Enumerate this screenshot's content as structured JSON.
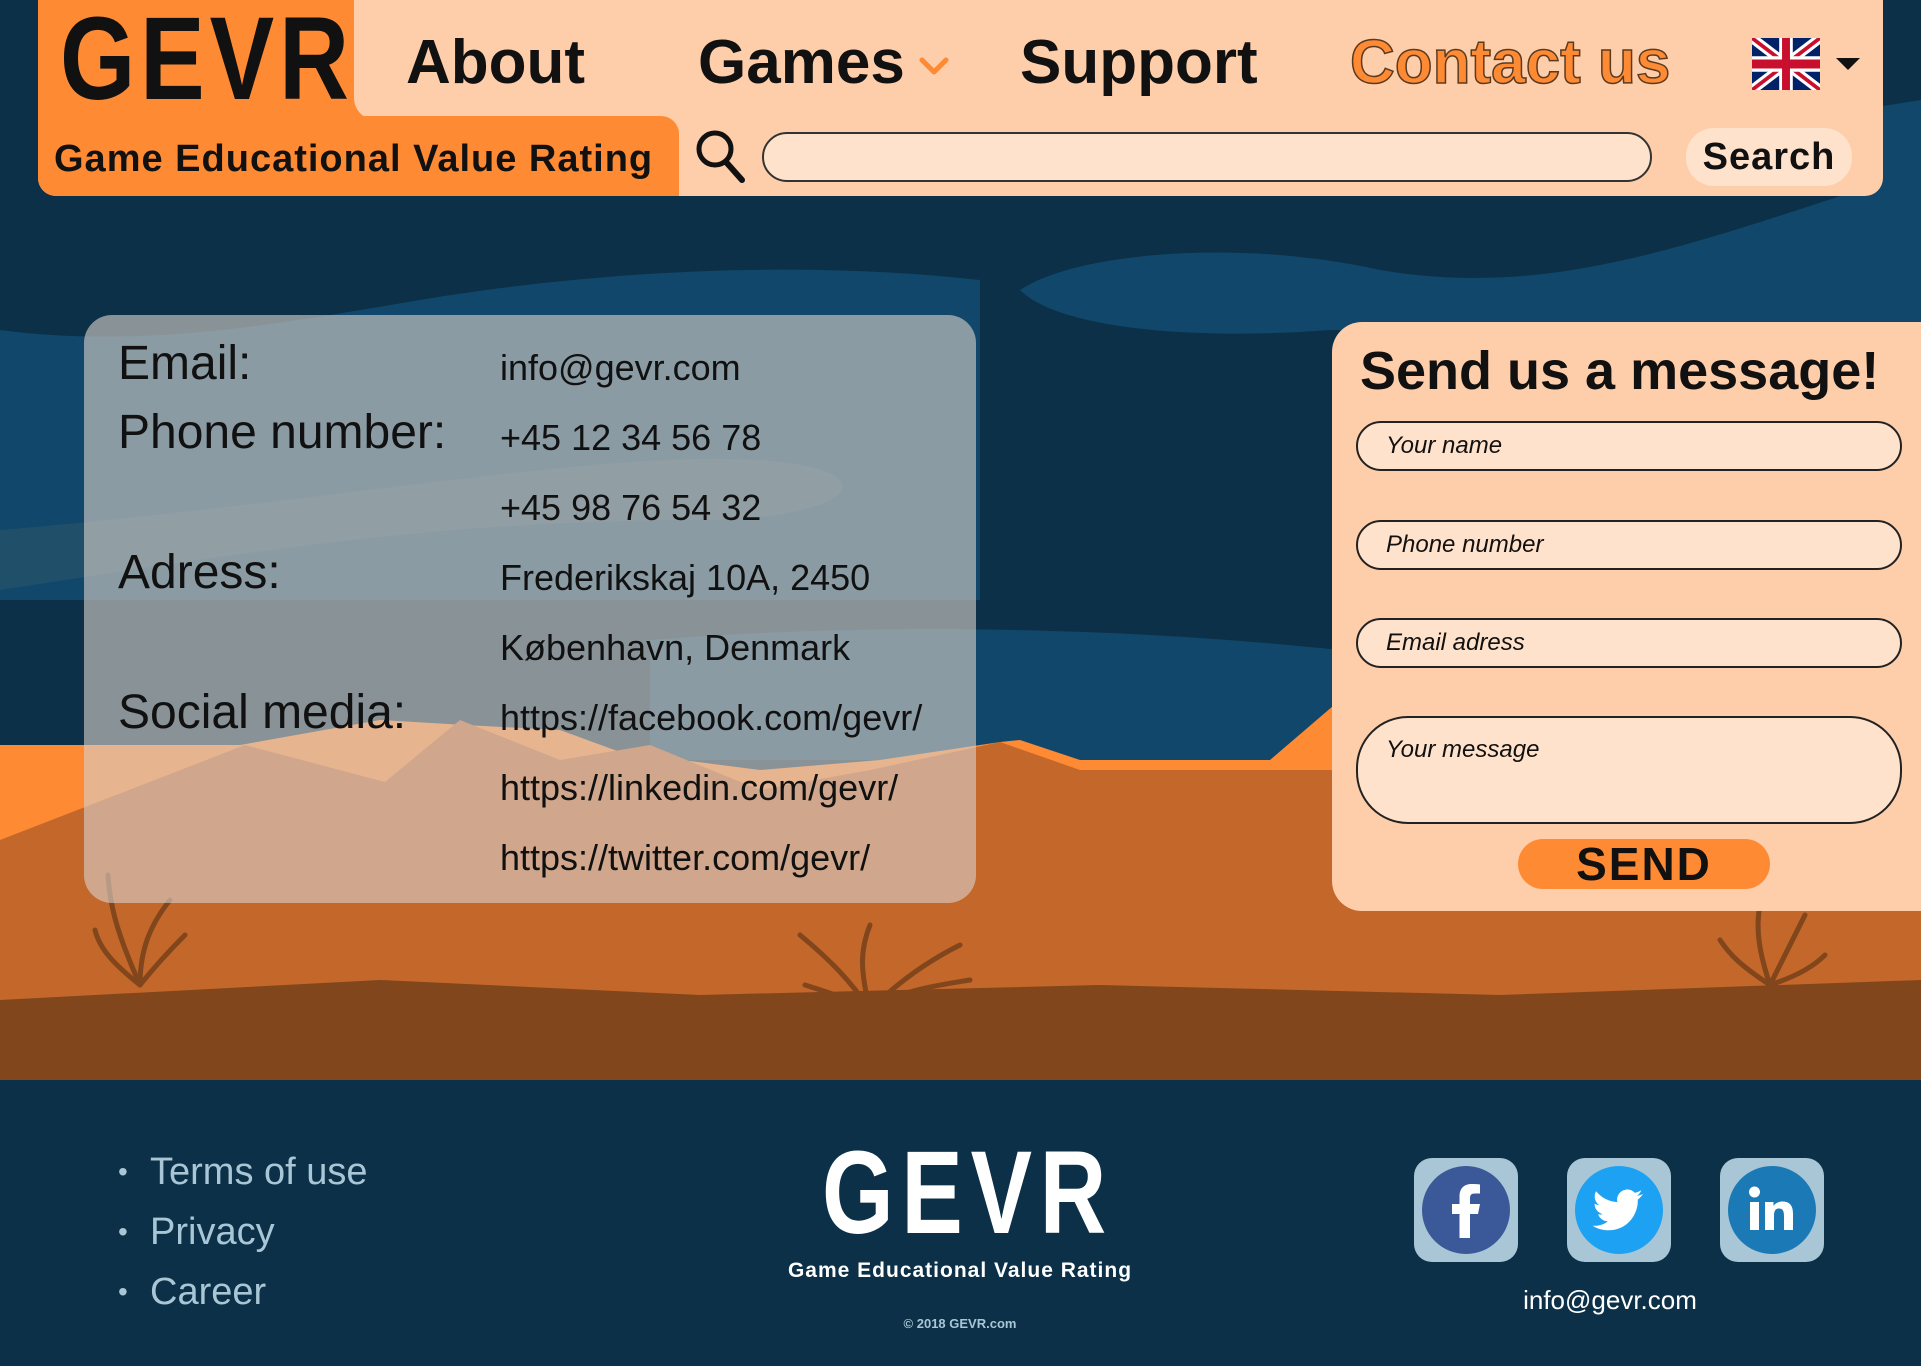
{
  "header": {
    "logo": "GEVR",
    "tagline": "Game Educational Value Rating",
    "nav": {
      "about": "About",
      "games": "Games",
      "support": "Support",
      "contact": "Contact us"
    },
    "language": "english-flag-icon",
    "search": {
      "placeholder": "",
      "button_label": "Search"
    }
  },
  "contact_info": {
    "email_label": "Email:",
    "email_value": "info@gevr.com",
    "phone_label": "Phone number:",
    "phone_1": "+45 12 34 56 78",
    "phone_2": "+45 98 76 54 32",
    "address_label": "Adress:",
    "address_line_1": "Frederikskaj 10A, 2450",
    "address_line_2": "København, Denmark",
    "social_label": "Social media:",
    "social_facebook": "https://facebook.com/gevr/",
    "social_linkedin": "https://linkedin.com/gevr/",
    "social_twitter": "https://twitter.com/gevr/"
  },
  "message_form": {
    "title": "Send us a message!",
    "name_placeholder": "Your name",
    "phone_placeholder": "Phone number",
    "email_placeholder": "Email adress",
    "message_placeholder": "Your message",
    "send_label": "SEND"
  },
  "footer": {
    "links": [
      "Terms of use",
      "Privacy",
      "Career"
    ],
    "logo": "GEVR",
    "tagline": "Game Educational Value Rating",
    "copyright": "© 2018 GEVR.com",
    "email": "info@gevr.com",
    "social_icons": [
      "facebook-icon",
      "twitter-icon",
      "linkedin-icon"
    ]
  },
  "colors": {
    "accent_orange": "#fe8a34",
    "header_peach": "#fecdaa",
    "navy": "#0c3047",
    "footer_link": "#a9c6d6"
  }
}
